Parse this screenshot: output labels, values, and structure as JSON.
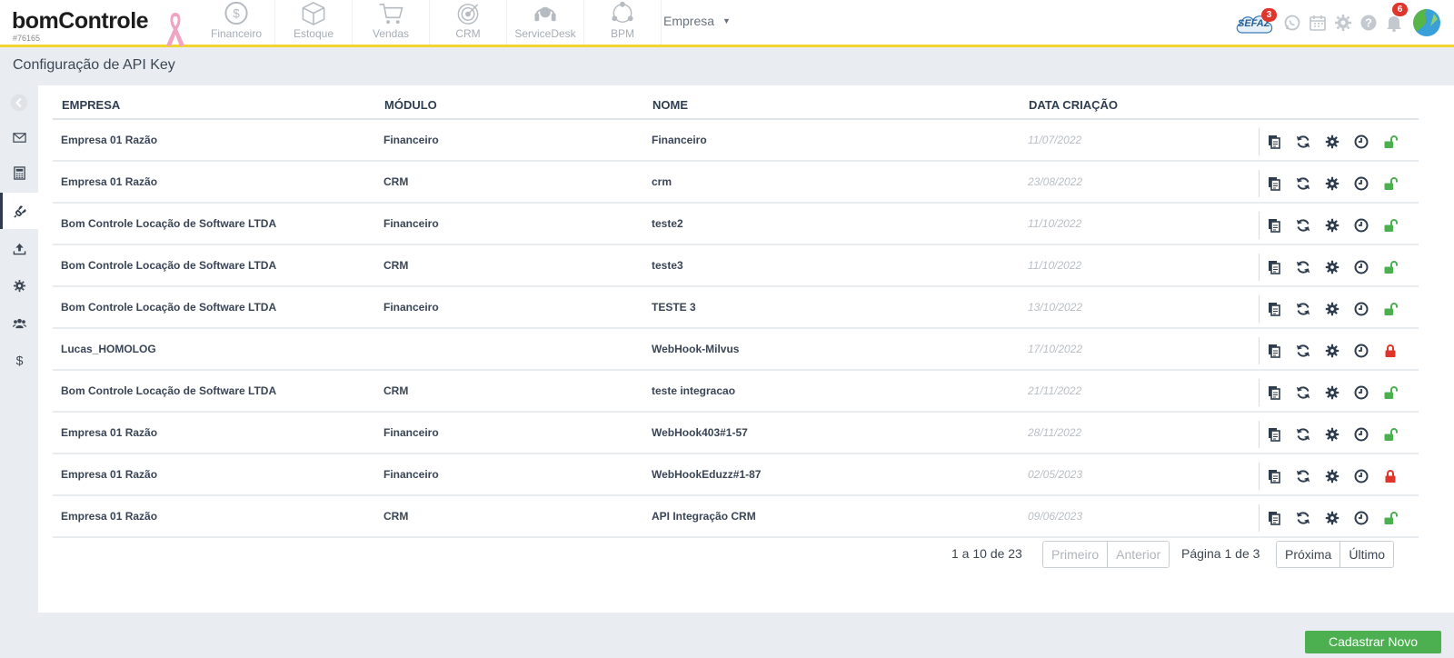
{
  "brand": {
    "name": "bomControle",
    "code": "#76165"
  },
  "modules": [
    {
      "label": "Financeiro",
      "icon": "dollar-circle-icon"
    },
    {
      "label": "Estoque",
      "icon": "box-icon"
    },
    {
      "label": "Vendas",
      "icon": "cart-icon"
    },
    {
      "label": "CRM",
      "icon": "target-icon"
    },
    {
      "label": "ServiceDesk",
      "icon": "headset-icon"
    },
    {
      "label": "BPM",
      "icon": "network-icon"
    }
  ],
  "empresa_selector": "Empresa",
  "header_badges": {
    "sefaz": "3",
    "notifications": "6",
    "sefaz_label": "SEFAZ"
  },
  "page_title": "Configuração de API Key",
  "table": {
    "columns": [
      "EMPRESA",
      "MÓDULO",
      "NOME",
      "DATA CRIAÇÃO"
    ],
    "rows": [
      {
        "empresa": "Empresa 01 Razão",
        "modulo": "Financeiro",
        "nome": "Financeiro",
        "data": "11/07/2022",
        "locked": false
      },
      {
        "empresa": "Empresa 01 Razão",
        "modulo": "CRM",
        "nome": "crm",
        "data": "23/08/2022",
        "locked": false
      },
      {
        "empresa": "Bom Controle Locação de Software LTDA",
        "modulo": "Financeiro",
        "nome": "teste2",
        "data": "11/10/2022",
        "locked": false
      },
      {
        "empresa": "Bom Controle Locação de Software LTDA",
        "modulo": "CRM",
        "nome": "teste3",
        "data": "11/10/2022",
        "locked": false
      },
      {
        "empresa": "Bom Controle Locação de Software LTDA",
        "modulo": "Financeiro",
        "nome": "TESTE 3",
        "data": "13/10/2022",
        "locked": false
      },
      {
        "empresa": "Lucas_HOMOLOG",
        "modulo": "",
        "nome": "WebHook-Milvus",
        "data": "17/10/2022",
        "locked": true
      },
      {
        "empresa": "Bom Controle Locação de Software LTDA",
        "modulo": "CRM",
        "nome": "teste integracao",
        "data": "21/11/2022",
        "locked": false
      },
      {
        "empresa": "Empresa 01 Razão",
        "modulo": "Financeiro",
        "nome": "WebHook403#1-57",
        "data": "28/11/2022",
        "locked": false
      },
      {
        "empresa": "Empresa 01 Razão",
        "modulo": "Financeiro",
        "nome": "WebHookEduzz#1-87",
        "data": "02/05/2023",
        "locked": true
      },
      {
        "empresa": "Empresa 01 Razão",
        "modulo": "CRM",
        "nome": "API Integração CRM",
        "data": "09/06/2023",
        "locked": false
      }
    ]
  },
  "pagination": {
    "info": "1 a 10 de 23",
    "first": "Primeiro",
    "prev": "Anterior",
    "page_of": "Página 1 de 3",
    "next": "Próxima",
    "last": "Último"
  },
  "new_button": "Cadastrar Novo",
  "colors": {
    "accent_yellow": "#f2d530",
    "unlock_green": "#4caf50",
    "lock_red": "#e0352b",
    "primary_green": "#4caf50"
  }
}
